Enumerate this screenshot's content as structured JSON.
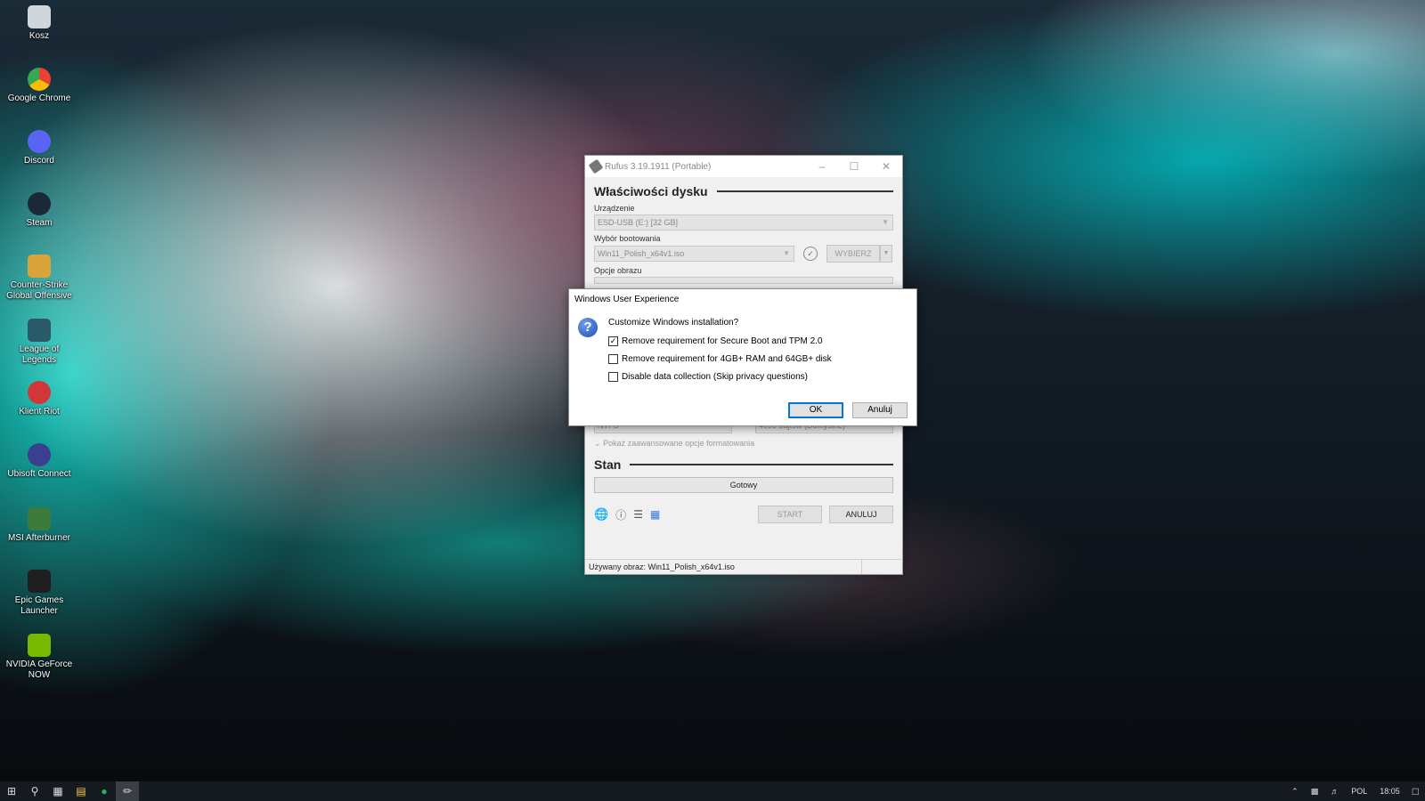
{
  "desktop": {
    "icons": [
      {
        "label": "Kosz",
        "icon": "recycle-bin-icon",
        "color": "#cfd6dc"
      },
      {
        "label": "Google Chrome",
        "icon": "chrome-icon",
        "color": "#e94235"
      },
      {
        "label": "Discord",
        "icon": "discord-icon",
        "color": "#5865f2"
      },
      {
        "label": "Steam",
        "icon": "steam-icon",
        "color": "#1b2838"
      },
      {
        "label": "Counter-Strike Global Offensive",
        "icon": "csgo-icon",
        "color": "#d9a53a"
      },
      {
        "label": "League of Legends",
        "icon": "lol-icon",
        "color": "#2a5a68"
      },
      {
        "label": "Klient Riot",
        "icon": "riot-icon",
        "color": "#d13639"
      },
      {
        "label": "Ubisoft Connect",
        "icon": "ubisoft-icon",
        "color": "#3b3f8f"
      },
      {
        "label": "MSI Afterburner",
        "icon": "msi-afterburner-icon",
        "color": "#3c7b3c"
      },
      {
        "label": "Epic Games Launcher",
        "icon": "epic-games-icon",
        "color": "#1e1e1e"
      },
      {
        "label": "NVIDIA GeForce NOW",
        "icon": "nvidia-icon",
        "color": "#76b900"
      }
    ]
  },
  "rufus": {
    "title": "Rufus 3.19.1911 (Portable)",
    "section_drive": "Właściwości dysku",
    "device_label": "Urządzenie",
    "device_value": "ESD-USB (E:) [32 GB]",
    "boot_label": "Wybór bootowania",
    "boot_value": "Win11_Polish_x64v1.iso",
    "select_button": "WYBIERZ",
    "image_options_label": "Opcje obrazu",
    "filesystem_value": "NTFS",
    "cluster_value": "4096 bajtów (Domyślne)",
    "advanced_toggle": "Pokaż zaawansowane opcje formatowania",
    "section_status": "Stan",
    "status_value": "Gotowy",
    "start_button": "START",
    "cancel_button": "ANULUJ",
    "statusbar_text": "Używany obraz: Win11_Polish_x64v1.iso"
  },
  "dialog": {
    "title": "Windows User Experience",
    "question": "Customize Windows installation?",
    "options": [
      {
        "label": "Remove requirement for Secure Boot and TPM 2.0",
        "checked": true
      },
      {
        "label": "Remove requirement for 4GB+ RAM and 64GB+ disk",
        "checked": false
      },
      {
        "label": "Disable data collection (Skip privacy questions)",
        "checked": false
      }
    ],
    "ok_button": "OK",
    "cancel_button": "Anuluj"
  },
  "taskbar": {
    "language": "POL",
    "time": "18:05"
  },
  "colors": {
    "accent": "#0078d7",
    "taskbar": "#151a20"
  }
}
